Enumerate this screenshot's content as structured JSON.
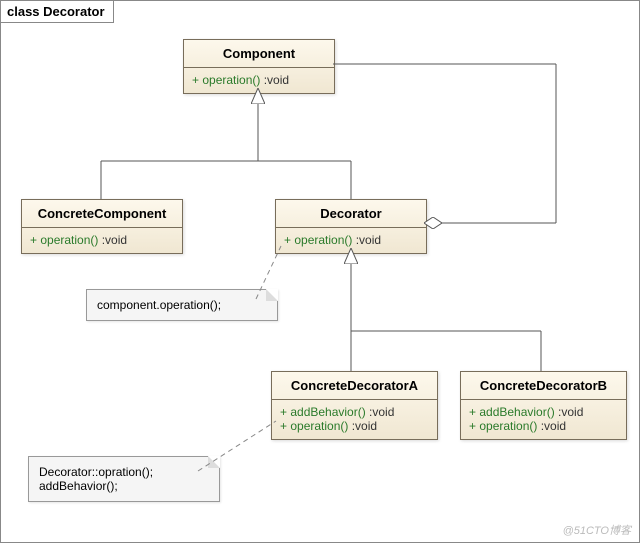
{
  "frame": {
    "title": "class Decorator"
  },
  "classes": {
    "component": {
      "name": "Component",
      "ops": [
        {
          "m": "+  operation()",
          "r": " :void"
        }
      ]
    },
    "concreteComponent": {
      "name": "ConcreteComponent",
      "ops": [
        {
          "m": "+  operation()",
          "r": " :void"
        }
      ]
    },
    "decorator": {
      "name": "Decorator",
      "ops": [
        {
          "m": "+  operation()",
          "r": " :void"
        }
      ]
    },
    "concreteDecoratorA": {
      "name": "ConcreteDecoratorA",
      "ops": [
        {
          "m": "+  addBehavior()",
          "r": " :void"
        },
        {
          "m": "+  operation()",
          "r": " :void"
        }
      ]
    },
    "concreteDecoratorB": {
      "name": "ConcreteDecoratorB",
      "ops": [
        {
          "m": "+  addBehavior()",
          "r": " :void"
        },
        {
          "m": "+  operation()",
          "r": " :void"
        }
      ]
    }
  },
  "notes": {
    "n1": "component.operation();",
    "n2a": "Decorator::opration();",
    "n2b": "addBehavior();"
  },
  "attribution": "@51CTO博客",
  "chart_data": {
    "type": "diagram",
    "title": "class Decorator",
    "nodes": [
      {
        "id": "Component",
        "type": "class",
        "ops": [
          "+ operation() :void"
        ]
      },
      {
        "id": "ConcreteComponent",
        "type": "class",
        "ops": [
          "+ operation() :void"
        ]
      },
      {
        "id": "Decorator",
        "type": "class",
        "ops": [
          "+ operation() :void"
        ]
      },
      {
        "id": "ConcreteDecoratorA",
        "type": "class",
        "ops": [
          "+ addBehavior() :void",
          "+ operation() :void"
        ]
      },
      {
        "id": "ConcreteDecoratorB",
        "type": "class",
        "ops": [
          "+ addBehavior() :void",
          "+ operation() :void"
        ]
      },
      {
        "id": "Note1",
        "type": "note",
        "text": "component.operation();"
      },
      {
        "id": "Note2",
        "type": "note",
        "text": "Decorator::opration(); addBehavior();"
      }
    ],
    "edges": [
      {
        "from": "ConcreteComponent",
        "to": "Component",
        "kind": "generalization"
      },
      {
        "from": "Decorator",
        "to": "Component",
        "kind": "generalization"
      },
      {
        "from": "ConcreteDecoratorA",
        "to": "Decorator",
        "kind": "generalization"
      },
      {
        "from": "ConcreteDecoratorB",
        "to": "Decorator",
        "kind": "generalization"
      },
      {
        "from": "Decorator",
        "to": "Component",
        "kind": "aggregation"
      },
      {
        "from": "Note1",
        "to": "Decorator",
        "kind": "attachment"
      },
      {
        "from": "Note2",
        "to": "ConcreteDecoratorA",
        "kind": "attachment"
      }
    ]
  }
}
